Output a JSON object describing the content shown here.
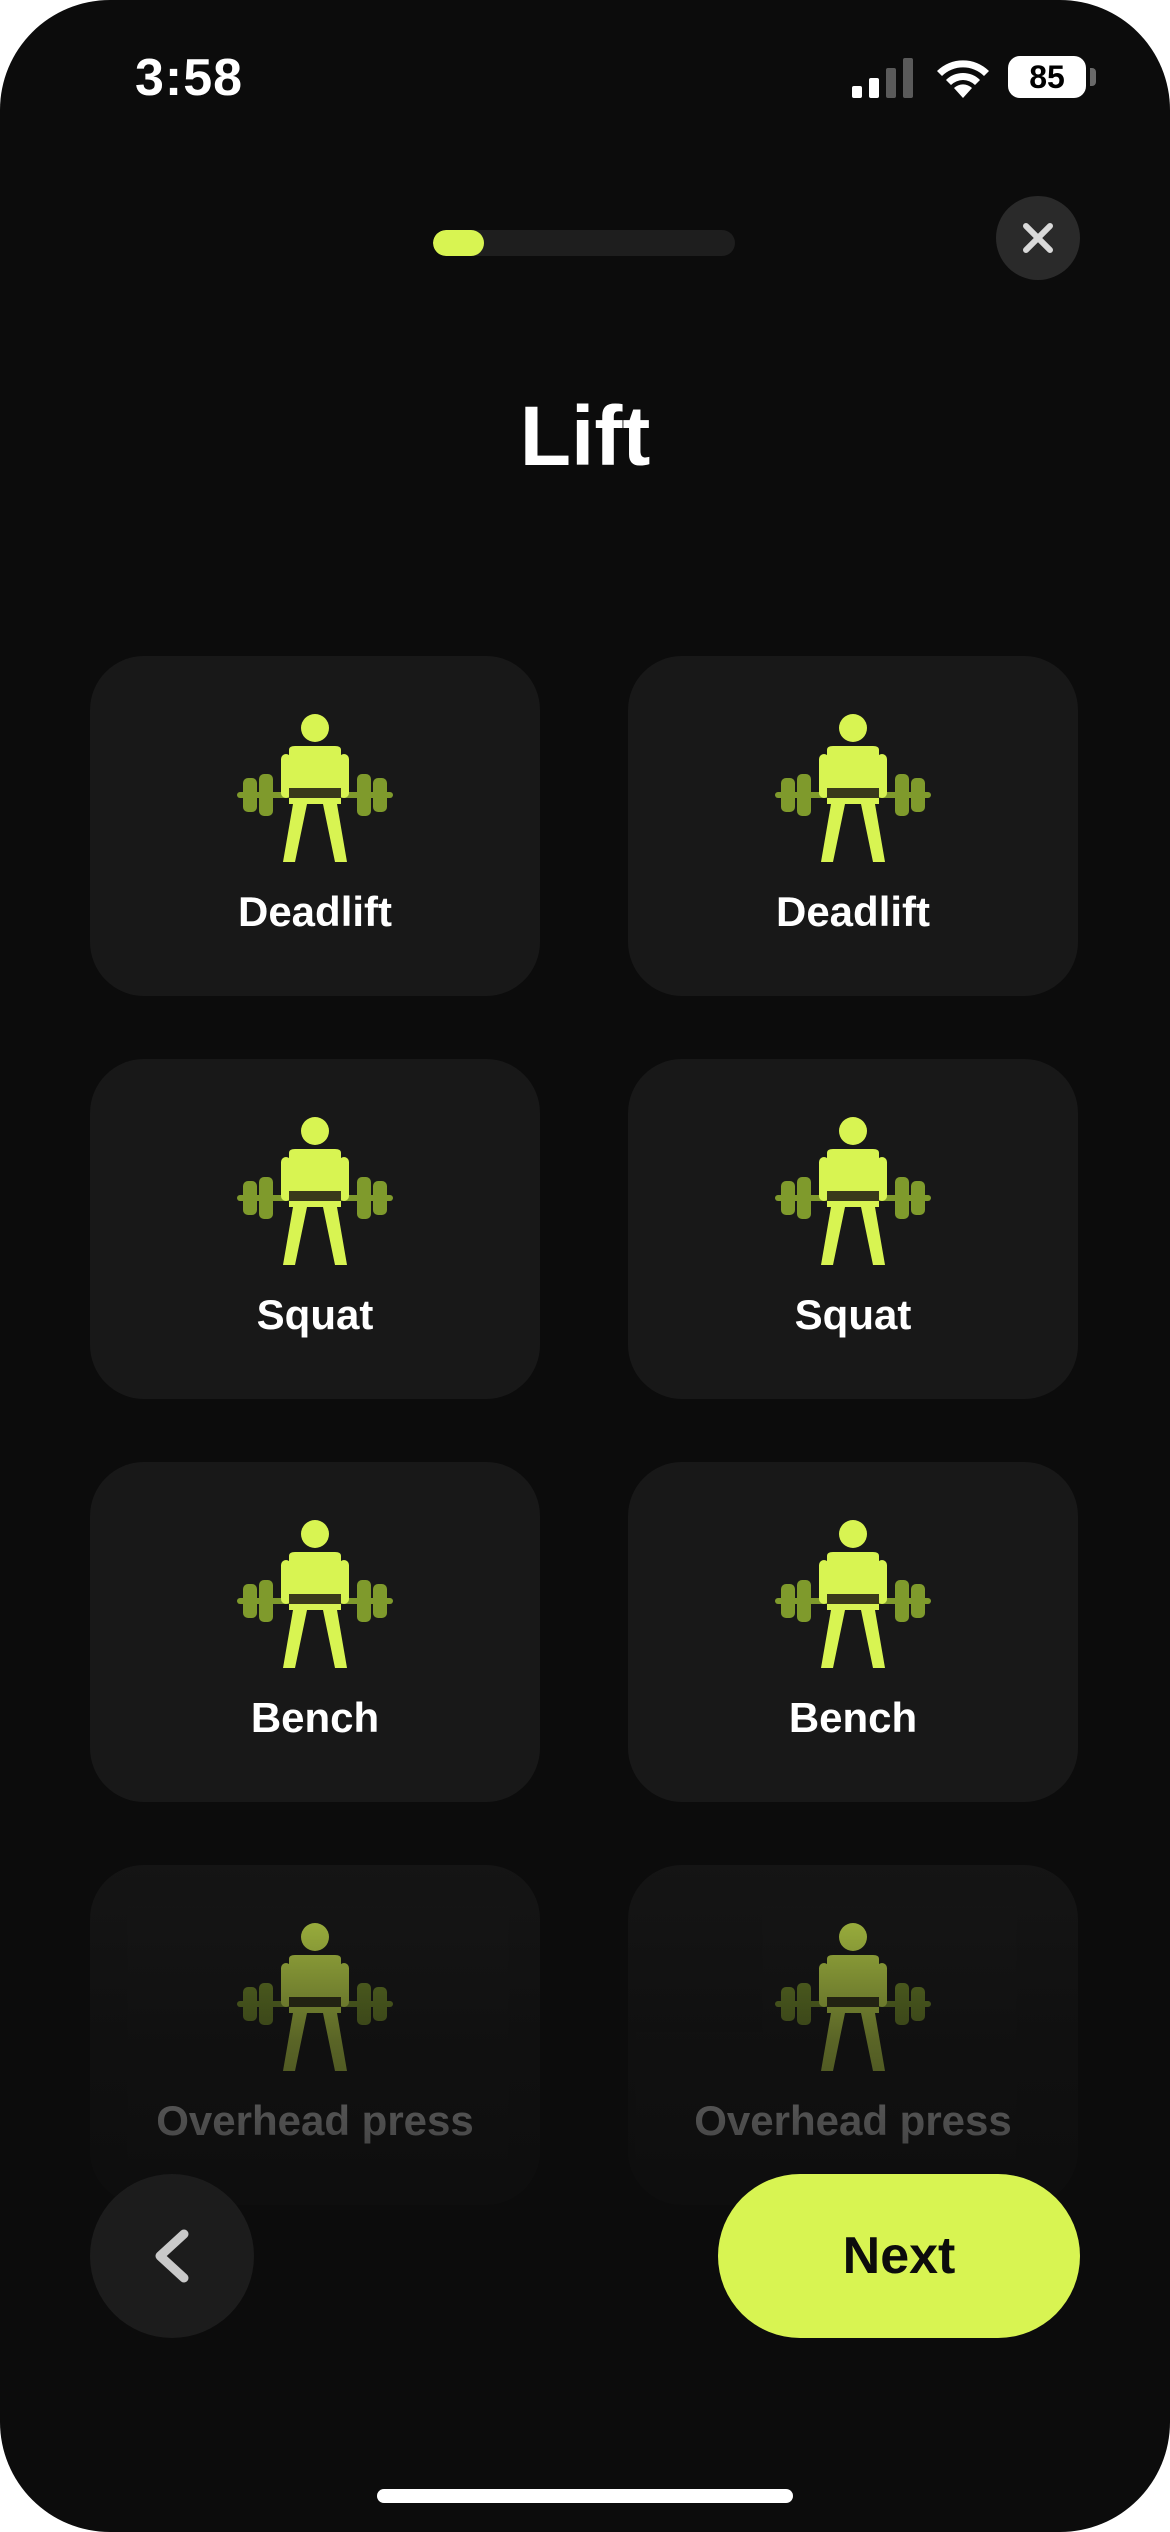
{
  "status_bar": {
    "time": "3:58",
    "battery": "85"
  },
  "progress": {
    "fraction": 0.17
  },
  "title": "Lift",
  "options": [
    {
      "label": "Deadlift"
    },
    {
      "label": "Deadlift"
    },
    {
      "label": "Squat"
    },
    {
      "label": "Squat"
    },
    {
      "label": "Bench"
    },
    {
      "label": "Bench"
    },
    {
      "label": "Overhead press"
    },
    {
      "label": "Overhead press"
    }
  ],
  "icons": {
    "close": "close-icon",
    "back": "chevron-left-icon",
    "lifter": "weightlifter-icon"
  },
  "buttons": {
    "next": "Next"
  },
  "colors": {
    "accent": "#d8f452",
    "accent_dark": "#7f9a2c",
    "background": "#0c0c0c",
    "card": "#181818"
  }
}
